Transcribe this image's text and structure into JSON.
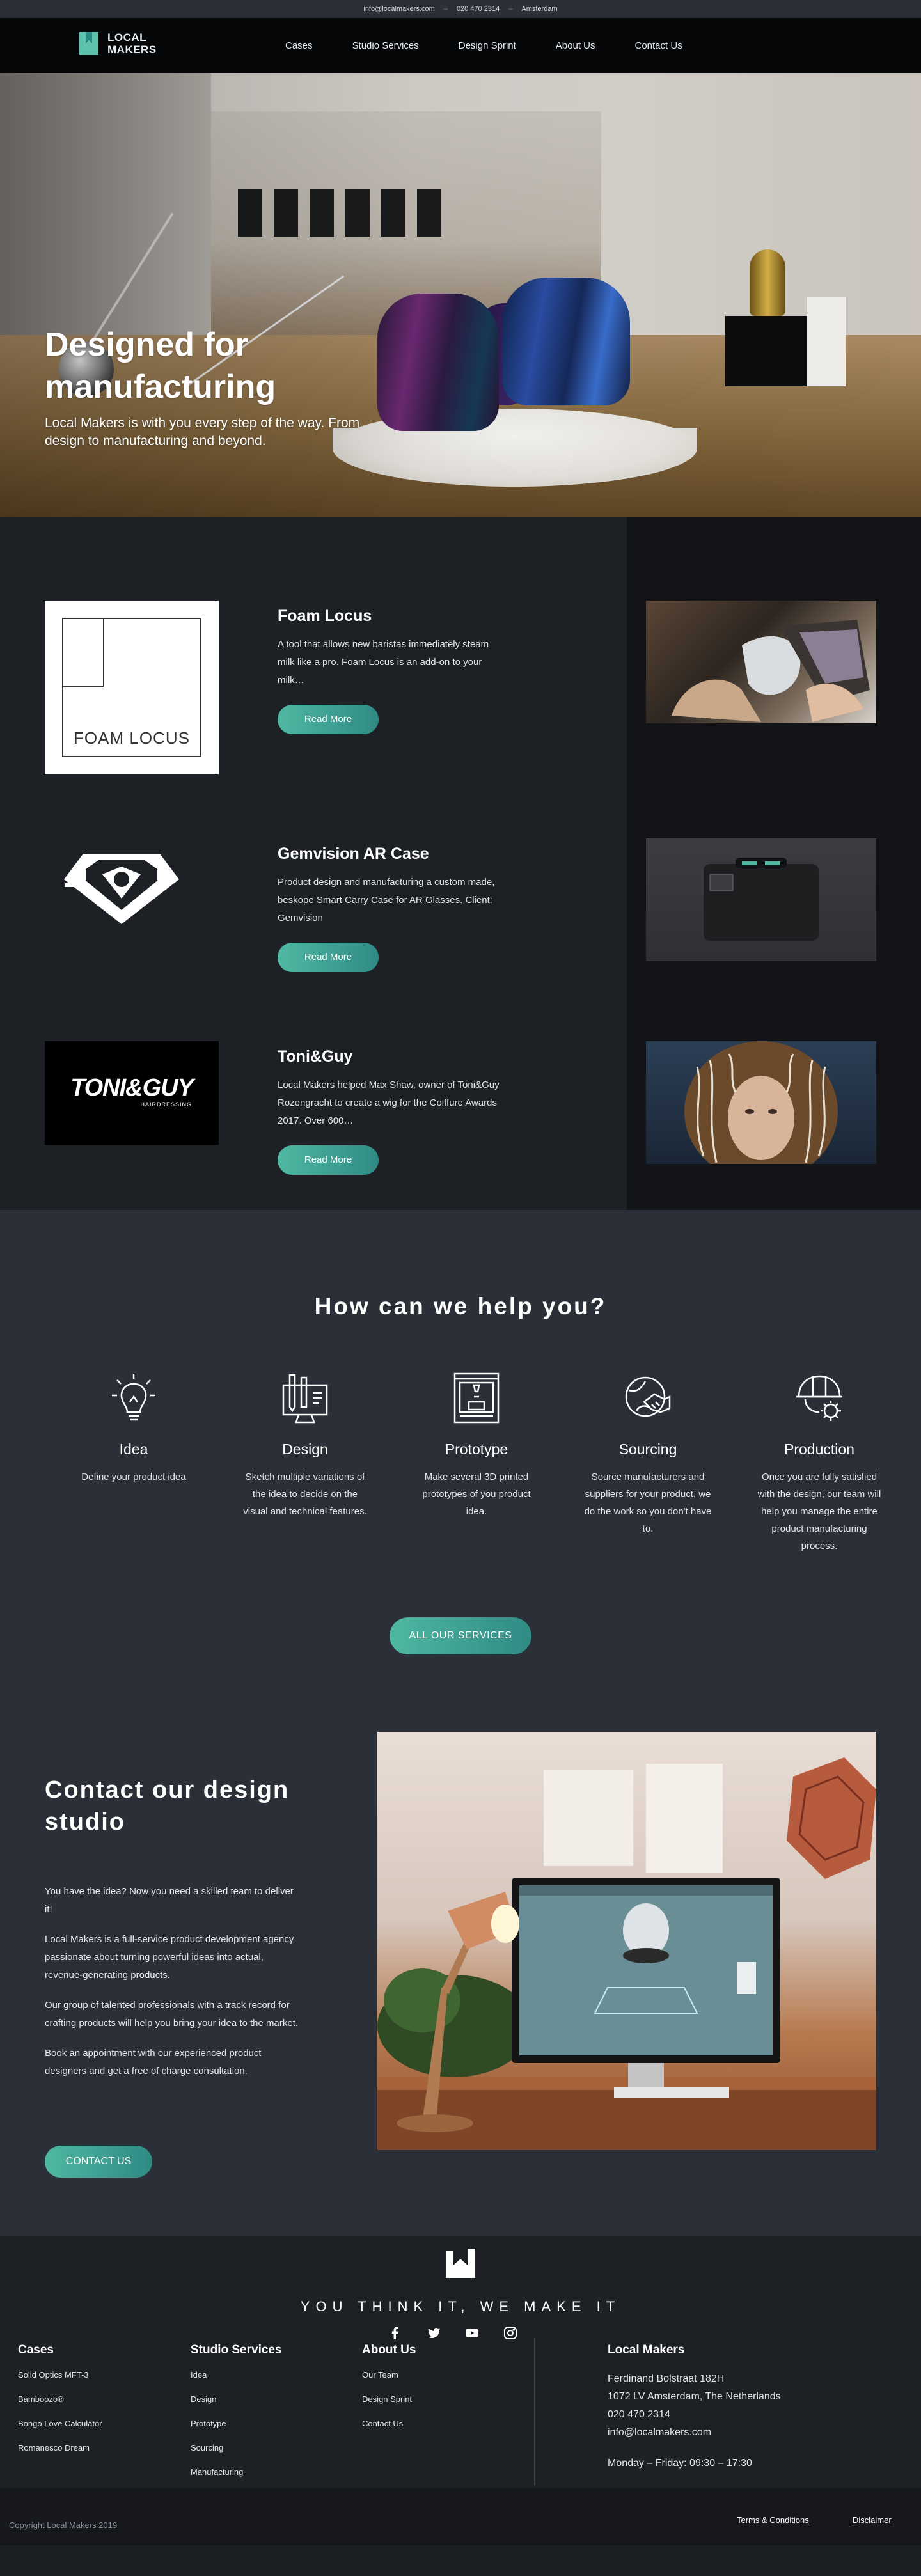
{
  "topbar": {
    "email": "info@localmakers.com",
    "sep1": "–",
    "phone": "020 470 2314",
    "sep2": "–",
    "city": "Amsterdam"
  },
  "header": {
    "logo_line1": "LOCAL",
    "logo_line2": "MAKERS",
    "nav": [
      "Cases",
      "Studio Services",
      "Design Sprint",
      "About Us",
      "Contact Us"
    ]
  },
  "hero": {
    "title": "Designed for manufacturing",
    "subtitle": "Local Makers is with you every step of the way. From design to manufacturing and beyond."
  },
  "cases": [
    {
      "logo_text": "FOAM LOCUS",
      "title": "Foam Locus",
      "description": "A tool that allows new baristas immediately steam milk like a pro. Foam Locus is an add-on to your milk…",
      "button": "Read More"
    },
    {
      "title": "Gemvision AR Case",
      "description": "Product design and manufacturing a custom made, beskope Smart Carry Case for AR Glasses. Client: Gemvision",
      "button": "Read More"
    },
    {
      "logo_text": "TONI&GUY",
      "logo_subtext": "HAIRDRESSING",
      "title": "Toni&Guy",
      "description": "Local Makers helped Max Shaw, owner of Toni&Guy Rozengracht to create a wig for the Coiffure Awards 2017. Over 600…",
      "button": "Read More"
    }
  ],
  "services": {
    "title": "How can we help you?",
    "items": [
      {
        "name": "Idea",
        "description": "Define your product idea",
        "icon": "lightbulb-icon"
      },
      {
        "name": "Design",
        "description": "Sketch multiple variations of the idea to decide on the visual and technical features.",
        "icon": "design-tools-icon"
      },
      {
        "name": "Prototype",
        "description": "Make several 3D printed prototypes of you product idea.",
        "icon": "3d-printer-icon"
      },
      {
        "name": "Sourcing",
        "description": "Source manufacturers and suppliers for your product, we do the work so you don't have to.",
        "icon": "handshake-globe-icon"
      },
      {
        "name": "Production",
        "description": "Once you are fully satisfied with the design, our team will help you manage the entire product manufacturing process.",
        "icon": "helmet-gear-icon"
      }
    ],
    "button": "ALL OUR SERVICES"
  },
  "studio": {
    "title": "Contact our design studio",
    "paragraphs": [
      "You have the idea? Now you need a skilled team to deliver it!",
      "Local Makers is a full-service product development agency passionate about turning powerful ideas into actual, revenue-generating products.",
      "Our group of talented professionals with a track record for crafting products will help you bring your idea to the market.",
      "Book an appointment with our experienced product designers and get a free of charge consultation."
    ],
    "button": "CONTACT US"
  },
  "footer": {
    "slogan": "YOU THINK IT, WE MAKE IT",
    "social": [
      "facebook-icon",
      "twitter-icon",
      "youtube-icon",
      "instagram-icon"
    ],
    "columns": [
      {
        "title": "Cases",
        "links": [
          "Solid Optics MFT-3",
          "Bamboozo®",
          "Bongo Love Calculator",
          "Romanesco Dream"
        ]
      },
      {
        "title": "Studio Services",
        "links": [
          "Idea",
          "Design",
          "Prototype",
          "Sourcing",
          "Manufacturing"
        ]
      },
      {
        "title": "About Us",
        "links": [
          "Our Team",
          "Design Sprint",
          "Contact Us"
        ]
      }
    ],
    "address": {
      "title": "Local Makers",
      "street": "Ferdinand Bolstraat 182H",
      "city": "1072 LV Amsterdam, The Netherlands",
      "phone": "020 470 2314",
      "email": "info@localmakers.com",
      "hours": "Monday – Friday: 09:30 – 17:30"
    },
    "copyright": "Copyright Local Makers 2019",
    "legal": [
      "Terms & Conditions",
      "Disclaimer"
    ]
  },
  "colors": {
    "accent": "#4fb8a2",
    "accent_dark": "#2f8a84",
    "bg_dark": "#1d2024",
    "bg_mid": "#2b2f37"
  }
}
